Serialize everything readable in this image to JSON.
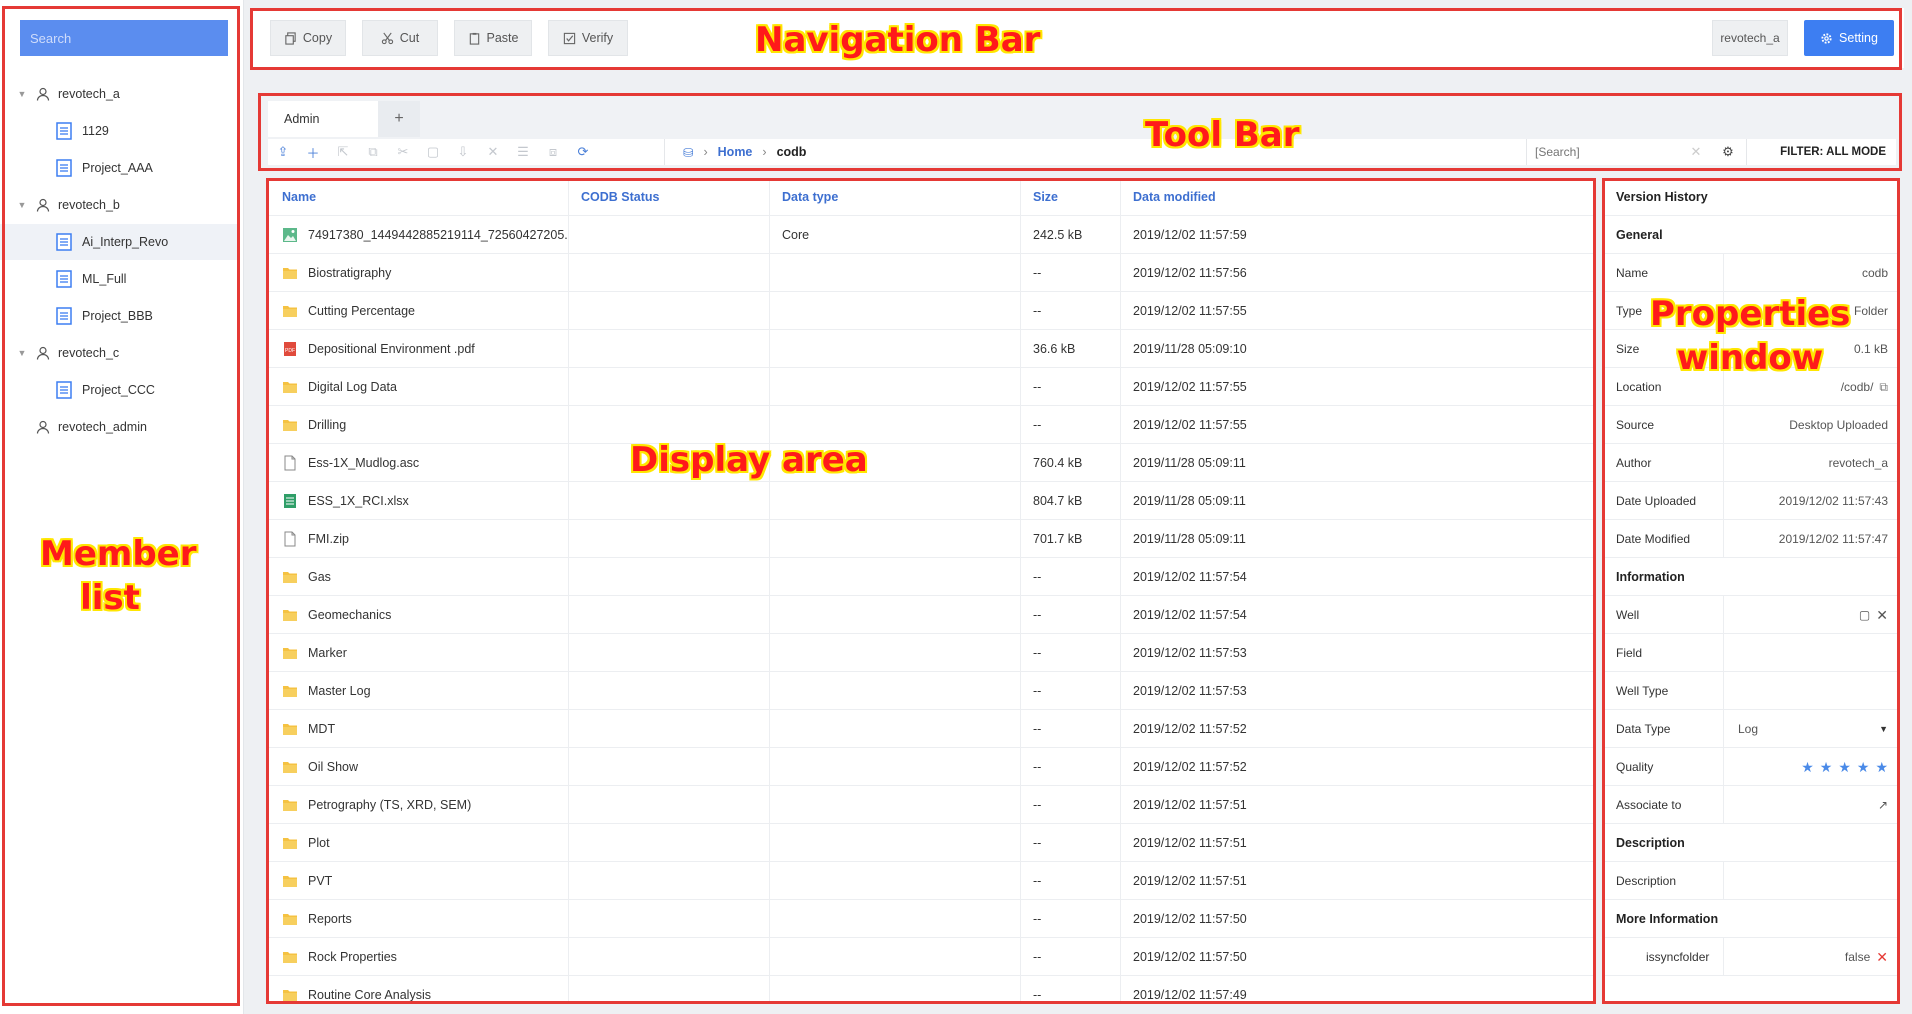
{
  "annotations": {
    "navigation_bar": "Navigation Bar",
    "tool_bar": "Tool Bar",
    "member_list_line1": "Member",
    "member_list_line2": "list",
    "display_area": "Display area",
    "properties_line1": "Properties",
    "properties_line2": "window",
    "color": "#e53935"
  },
  "sidebar": {
    "search_placeholder": "Search",
    "items": [
      {
        "label": "revotech_a",
        "kind": "user",
        "expanded": true
      },
      {
        "label": "1129",
        "kind": "project"
      },
      {
        "label": "Project_AAA",
        "kind": "project"
      },
      {
        "label": "revotech_b",
        "kind": "user",
        "expanded": true
      },
      {
        "label": "Ai_Interp_Revo",
        "kind": "project",
        "selected": true
      },
      {
        "label": "ML_Full",
        "kind": "project"
      },
      {
        "label": "Project_BBB",
        "kind": "project"
      },
      {
        "label": "revotech_c",
        "kind": "user",
        "expanded": true
      },
      {
        "label": "Project_CCC",
        "kind": "project"
      },
      {
        "label": "revotech_admin",
        "kind": "user"
      }
    ]
  },
  "navbar": {
    "copy": "Copy",
    "cut": "Cut",
    "paste": "Paste",
    "verify": "Verify",
    "user": "revotech_a",
    "setting": "Setting"
  },
  "toolbar": {
    "tabs": [
      "Admin"
    ],
    "add_tab": "+",
    "breadcrumb_home": "Home",
    "breadcrumb_current": "codb",
    "search_placeholder": "[Search]",
    "filter": "FILTER: ALL MODE"
  },
  "table": {
    "headers": {
      "name": "Name",
      "codb": "CODB Status",
      "type": "Data type",
      "size": "Size",
      "modified": "Data modified"
    },
    "rows": [
      {
        "name": "74917380_1449442885219114_72560427205...",
        "icon": "image",
        "codb": "",
        "type": "Core",
        "size": "242.5 kB",
        "modified": "2019/12/02 11:57:59"
      },
      {
        "name": "Biostratigraphy",
        "icon": "folder",
        "codb": "",
        "type": "",
        "size": "--",
        "modified": "2019/12/02 11:57:56"
      },
      {
        "name": "Cutting Percentage",
        "icon": "folder",
        "codb": "",
        "type": "",
        "size": "--",
        "modified": "2019/12/02 11:57:55"
      },
      {
        "name": "Depositional Environment .pdf",
        "icon": "pdf",
        "codb": "",
        "type": "",
        "size": "36.6 kB",
        "modified": "2019/11/28 05:09:10"
      },
      {
        "name": "Digital Log Data",
        "icon": "folder",
        "codb": "",
        "type": "",
        "size": "--",
        "modified": "2019/12/02 11:57:55"
      },
      {
        "name": "Drilling",
        "icon": "folder",
        "codb": "",
        "type": "",
        "size": "--",
        "modified": "2019/12/02 11:57:55"
      },
      {
        "name": "Ess-1X_Mudlog.asc",
        "icon": "file",
        "codb": "",
        "type": "",
        "size": "760.4 kB",
        "modified": "2019/11/28 05:09:11"
      },
      {
        "name": "ESS_1X_RCI.xlsx",
        "icon": "sheet",
        "codb": "",
        "type": "",
        "size": "804.7 kB",
        "modified": "2019/11/28 05:09:11"
      },
      {
        "name": "FMI.zip",
        "icon": "file",
        "codb": "",
        "type": "",
        "size": "701.7 kB",
        "modified": "2019/11/28 05:09:11"
      },
      {
        "name": "Gas",
        "icon": "folder",
        "codb": "",
        "type": "",
        "size": "--",
        "modified": "2019/12/02 11:57:54"
      },
      {
        "name": "Geomechanics",
        "icon": "folder",
        "codb": "",
        "type": "",
        "size": "--",
        "modified": "2019/12/02 11:57:54"
      },
      {
        "name": "Marker",
        "icon": "folder",
        "codb": "",
        "type": "",
        "size": "--",
        "modified": "2019/12/02 11:57:53"
      },
      {
        "name": "Master Log",
        "icon": "folder",
        "codb": "",
        "type": "",
        "size": "--",
        "modified": "2019/12/02 11:57:53"
      },
      {
        "name": "MDT",
        "icon": "folder",
        "codb": "",
        "type": "",
        "size": "--",
        "modified": "2019/12/02 11:57:52"
      },
      {
        "name": "Oil Show",
        "icon": "folder",
        "codb": "",
        "type": "",
        "size": "--",
        "modified": "2019/12/02 11:57:52"
      },
      {
        "name": "Petrography (TS, XRD, SEM)",
        "icon": "folder",
        "codb": "",
        "type": "",
        "size": "--",
        "modified": "2019/12/02 11:57:51"
      },
      {
        "name": "Plot",
        "icon": "folder",
        "codb": "",
        "type": "",
        "size": "--",
        "modified": "2019/12/02 11:57:51"
      },
      {
        "name": "PVT",
        "icon": "folder",
        "codb": "",
        "type": "",
        "size": "--",
        "modified": "2019/12/02 11:57:51"
      },
      {
        "name": "Reports",
        "icon": "folder",
        "codb": "",
        "type": "",
        "size": "--",
        "modified": "2019/12/02 11:57:50"
      },
      {
        "name": "Rock Properties",
        "icon": "folder",
        "codb": "",
        "type": "",
        "size": "--",
        "modified": "2019/12/02 11:57:50"
      },
      {
        "name": "Routine Core Analysis",
        "icon": "folder",
        "codb": "",
        "type": "",
        "size": "--",
        "modified": "2019/12/02 11:57:49"
      }
    ]
  },
  "properties": {
    "version_history": "Version History",
    "general": "General",
    "name_key": "Name",
    "name_val": "codb",
    "type_key": "Type",
    "type_val": "Folder",
    "size_key": "Size",
    "size_val": "0.1  kB",
    "location_key": "Location",
    "location_val": "/codb/",
    "source_key": "Source",
    "source_val": "Desktop Uploaded",
    "author_key": "Author",
    "author_val": "revotech_a",
    "uploaded_key": "Date Uploaded",
    "uploaded_val": "2019/12/02 11:57:43",
    "modified_key": "Date Modified",
    "modified_val": "2019/12/02 11:57:47",
    "information": "Information",
    "well_key": "Well",
    "field_key": "Field",
    "welltype_key": "Well Type",
    "datatype_key": "Data Type",
    "datatype_val": "Log",
    "quality_key": "Quality",
    "quality_stars": 5,
    "associate_key": "Associate to",
    "description_sec": "Description",
    "description_key": "Description",
    "more_info": "More Information",
    "issync_key": "issyncfolder",
    "issync_val": "false"
  },
  "colors": {
    "accent": "#3d7ef2",
    "search_bg": "#5b8def",
    "link": "#3d6fd0",
    "folder": "#f5c242"
  }
}
